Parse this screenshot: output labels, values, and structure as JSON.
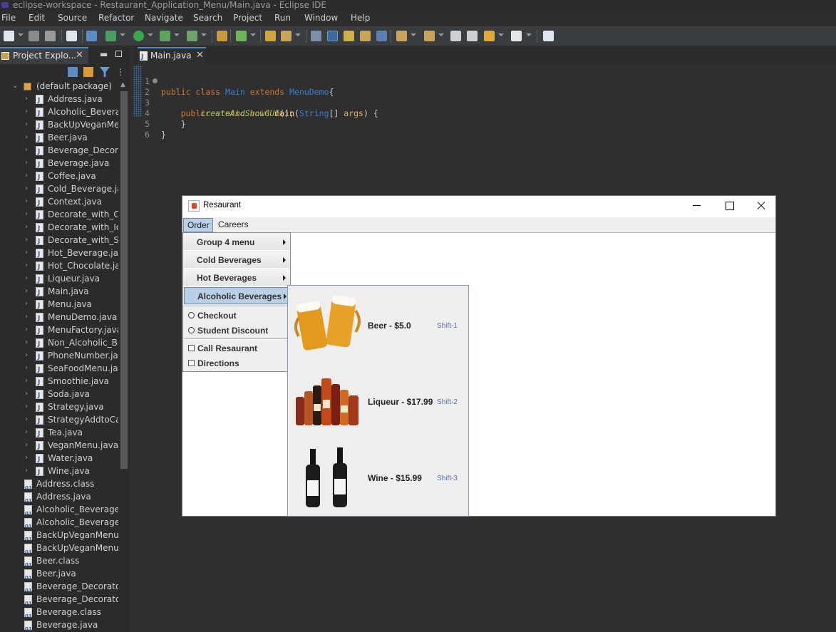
{
  "window_title": "eclipse-workspace - Restaurant_Application_Menu/Main.java - Eclipse IDE",
  "menubar": [
    "File",
    "Edit",
    "Source",
    "Refactor",
    "Navigate",
    "Search",
    "Project",
    "Run",
    "Window",
    "Help"
  ],
  "project_explorer": {
    "tab_label": "Project Explo...",
    "package": "(default package)",
    "java_files": [
      "Address.java",
      "Alcoholic_Beverag",
      "BackUpVeganMenu",
      "Beer.java",
      "Beverage_Decorato",
      "Beverage.java",
      "Coffee.java",
      "Cold_Beverage.java",
      "Context.java",
      "Decorate_with_Cre",
      "Decorate_with_Ice.",
      "Decorate_with_Sug",
      "Hot_Beverage.java",
      "Hot_Chocolate.java",
      "Liqueur.java",
      "Main.java",
      "Menu.java",
      "MenuDemo.java",
      "MenuFactory.java",
      "Non_Alcoholic_Be",
      "PhoneNumber.java",
      "SeaFoodMenu.java",
      "Smoothie.java",
      "Soda.java",
      "Strategy.java",
      "StrategyAddtoCart",
      "Tea.java",
      "VeganMenu.java",
      "Water.java",
      "Wine.java"
    ],
    "bin_files": [
      "Address.class",
      "Address.java",
      "Alcoholic_Beverage.cl",
      "Alcoholic_Beverage.ja",
      "BackUpVeganMenu.cl",
      "BackUpVeganMenu.ja",
      "Beer.class",
      "Beer.java",
      "Beverage_Decorator.c",
      "Beverage_Decorator.ja",
      "Beverage.class",
      "Beverage.java"
    ]
  },
  "editor": {
    "tab_label": "Main.java",
    "line_numbers": [
      "1",
      "2",
      "3",
      "4",
      "5",
      "6"
    ],
    "code": {
      "l1": {
        "kw1": "public",
        "kw2": "class",
        "cls": "Main",
        "kw3": "extends",
        "parent": "MenuDemo",
        "brace": "{"
      },
      "l2": {
        "kw1": "public",
        "kw2": "static",
        "kw3": "void",
        "mth": "main",
        "paren": "(",
        "type": "String",
        "arr": "[] ",
        "arg": "args",
        "close": ") {"
      },
      "l3": {
        "call": "createAndShowGUI",
        "end": "();"
      },
      "l4": "}",
      "l5": "}"
    }
  },
  "swing_app": {
    "title": "Resaurant",
    "menus": [
      "Order",
      "Careers"
    ],
    "order_menu": {
      "submenus": [
        "Group 4 menu",
        "Cold Beverages",
        "Hot Beverages",
        "Alcoholic Beverages"
      ],
      "radios": [
        "Checkout",
        "Student Discount"
      ],
      "checkboxes": [
        "Call Resaurant",
        "Directions"
      ]
    },
    "alcoholic_submenu": [
      {
        "label": "Beer - $5.0",
        "accelerator": "Shift-1",
        "image": "beer-mugs"
      },
      {
        "label": "Liqueur - $17.99",
        "accelerator": "Shift-2",
        "image": "liqueur-bottles"
      },
      {
        "label": "Wine - $15.99",
        "accelerator": "Shift-3",
        "image": "wine-bottles"
      }
    ]
  }
}
